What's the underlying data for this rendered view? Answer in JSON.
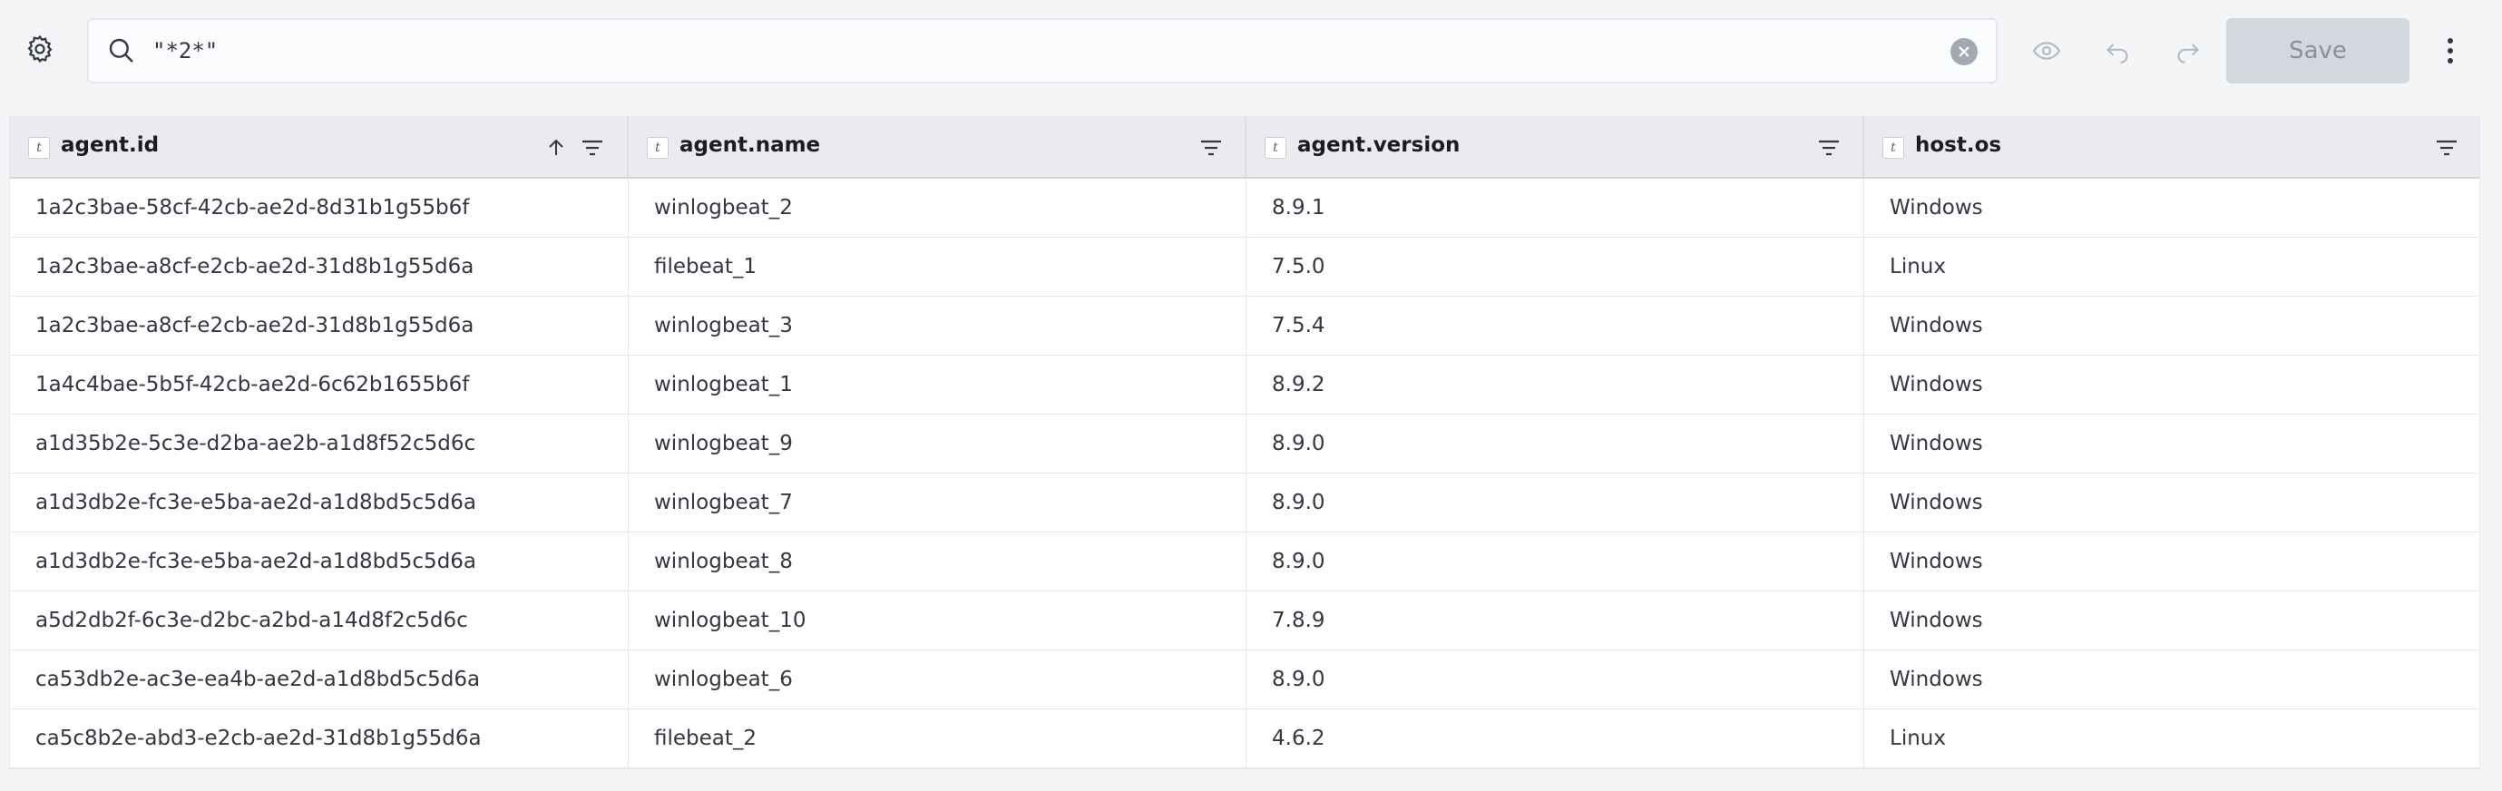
{
  "toolbar": {
    "search": {
      "value": "\"*2*\"",
      "placeholder": ""
    },
    "save_label": "Save"
  },
  "table": {
    "columns": [
      {
        "name": "agent.id",
        "type_glyph": "t"
      },
      {
        "name": "agent.name",
        "type_glyph": "t"
      },
      {
        "name": "agent.version",
        "type_glyph": "t"
      },
      {
        "name": "host.os",
        "type_glyph": "t"
      }
    ],
    "sort": {
      "column": "agent.id",
      "direction": "ascending"
    },
    "rows": [
      [
        "1a2c3bae-58cf-42cb-ae2d-8d31b1g55b6f",
        "winlogbeat_2",
        "8.9.1",
        "Windows"
      ],
      [
        "1a2c3bae-a8cf-e2cb-ae2d-31d8b1g55d6a",
        "filebeat_1",
        "7.5.0",
        "Linux"
      ],
      [
        "1a2c3bae-a8cf-e2cb-ae2d-31d8b1g55d6a",
        "winlogbeat_3",
        "7.5.4",
        "Windows"
      ],
      [
        "1a4c4bae-5b5f-42cb-ae2d-6c62b1655b6f",
        "winlogbeat_1",
        "8.9.2",
        "Windows"
      ],
      [
        "a1d35b2e-5c3e-d2ba-ae2b-a1d8f52c5d6c",
        "winlogbeat_9",
        "8.9.0",
        "Windows"
      ],
      [
        "a1d3db2e-fc3e-e5ba-ae2d-a1d8bd5c5d6a",
        "winlogbeat_7",
        "8.9.0",
        "Windows"
      ],
      [
        "a1d3db2e-fc3e-e5ba-ae2d-a1d8bd5c5d6a",
        "winlogbeat_8",
        "8.9.0",
        "Windows"
      ],
      [
        "a5d2db2f-6c3e-d2bc-a2bd-a14d8f2c5d6c",
        "winlogbeat_10",
        "7.8.9",
        "Windows"
      ],
      [
        "ca53db2e-ac3e-ea4b-ae2d-a1d8bd5c5d6a",
        "winlogbeat_6",
        "8.9.0",
        "Windows"
      ],
      [
        "ca5c8b2e-abd3-e2cb-ae2d-31d8b1g55d6a",
        "filebeat_2",
        "4.6.2",
        "Linux"
      ]
    ]
  },
  "colors": {
    "disabled_button": "#d4d7dd",
    "header_bg": "#e9ebef",
    "page_bg": "#f4f5f7"
  },
  "icons": [
    "gear-icon",
    "search-icon",
    "clear-icon",
    "eye-icon",
    "undo-icon",
    "redo-icon",
    "kebab-menu-icon",
    "sort-ascending-icon",
    "filter-icon"
  ]
}
